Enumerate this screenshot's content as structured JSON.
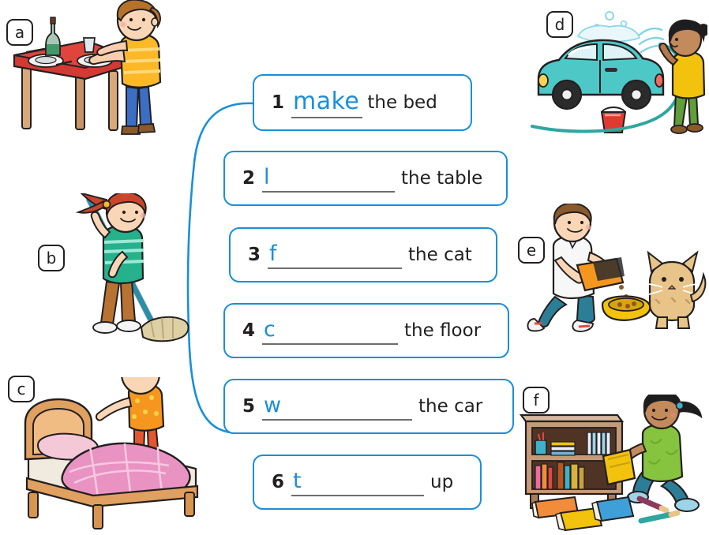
{
  "worksheet": {
    "accent_color": "#1a8fd8",
    "text_color": "#221f1f",
    "rule_color": "#6d6d6d",
    "exercises": [
      {
        "number": "1",
        "answer": "make",
        "blank": false,
        "tail": "the bed"
      },
      {
        "number": "2",
        "answer": "l",
        "blank": true,
        "tail": "the table"
      },
      {
        "number": "3",
        "answer": "f",
        "blank": true,
        "tail": "the cat"
      },
      {
        "number": "4",
        "answer": "c",
        "blank": true,
        "tail": "the floor"
      },
      {
        "number": "5",
        "answer": "w",
        "blank": true,
        "tail": "the car"
      },
      {
        "number": "6",
        "answer": "t",
        "blank": true,
        "tail": "up"
      }
    ],
    "picture_labels": [
      {
        "letter": "a",
        "scene": "boy setting the table"
      },
      {
        "letter": "b",
        "scene": "girl mopping the floor"
      },
      {
        "letter": "c",
        "scene": "boy making the bed"
      },
      {
        "letter": "d",
        "scene": "child washing the car"
      },
      {
        "letter": "e",
        "scene": "boy feeding the cat"
      },
      {
        "letter": "f",
        "scene": "girl tidying up books"
      }
    ],
    "connector": {
      "from": "exercise-1",
      "to": "picture-c",
      "color": "#1a8fd8"
    }
  }
}
